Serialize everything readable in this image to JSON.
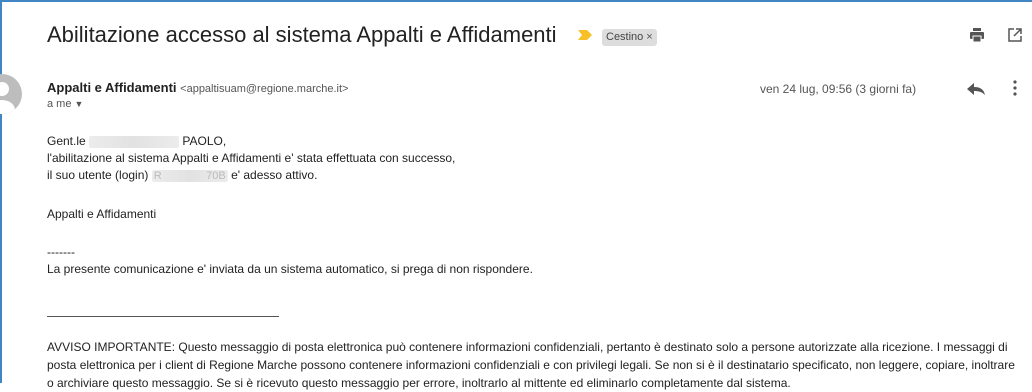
{
  "email": {
    "subject": "Abilitazione accesso al sistema Appalti e Affidamenti",
    "label": "Cestino",
    "label_close": "×",
    "sender_name": "Appalti e Affidamenti",
    "sender_address": "<appaltisuam@regione.marche.it>",
    "recipient": "a me",
    "date": "ven 24 lug, 09:56 (3 giorni fa)",
    "greeting_prefix": "Gent.le",
    "greeting_suffix": "PAOLO,",
    "line1": "l'abilitazione al sistema Appalti e Affidamenti e' stata effettuata con successo,",
    "line2_prefix": "il suo utente (login)",
    "line2_suffix": "e' adesso attivo.",
    "login_start": "R",
    "login_end": "70B",
    "signature": "Appalti e Affidamenti",
    "separator": "-------",
    "auto_notice": "La presente comunicazione e' inviata da un sistema automatico, si prega di non rispondere.",
    "warning": "AVVISO IMPORTANTE: Questo messaggio di posta elettronica può contenere informazioni confidenziali, pertanto è destinato solo a persone autorizzate alla ricezione. I messaggi di posta elettronica per i client di Regione Marche possono contenere informazioni confidenziali e con privilegi legali. Se non si è il destinatario specificato, non leggere, copiare, inoltrare o archiviare questo messaggio. Se si è ricevuto questo messaggio per errore, inoltrarlo al mittente ed eliminarlo completamente dal sistema."
  },
  "icons": {
    "print": "print-icon",
    "open_new_window": "open-in-new-window-icon",
    "reply": "reply-icon",
    "more": "more-vert-icon",
    "importance": "importance-marker-icon",
    "avatar": "avatar-icon"
  },
  "colors": {
    "importance_marker": "#f6c026",
    "label_background": "#dddddd",
    "frame_accent": "#4285c4"
  }
}
